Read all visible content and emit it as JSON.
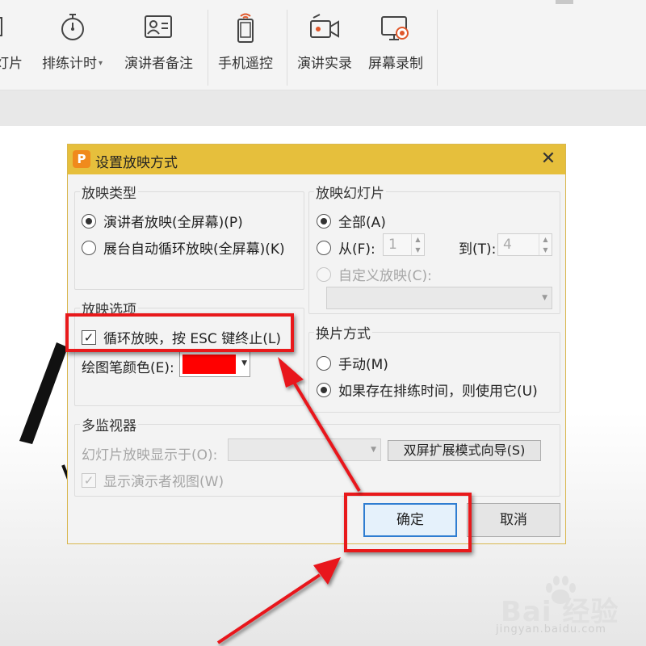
{
  "ribbon": {
    "items": [
      {
        "name": "slides",
        "label": "灯片",
        "icon": "slides-icon"
      },
      {
        "name": "rehearse-timings",
        "label": "排练计时",
        "icon": "stopwatch-icon",
        "has_dropdown": true
      },
      {
        "name": "speaker-notes",
        "label": "演讲者备注",
        "icon": "speaker-notes-icon"
      },
      {
        "name": "phone-remote",
        "label": "手机遥控",
        "icon": "phone-icon"
      },
      {
        "name": "record-presentation",
        "label": "演讲实录",
        "icon": "video-camera-icon"
      },
      {
        "name": "screen-recording",
        "label": "屏幕录制",
        "icon": "screen-record-icon"
      }
    ]
  },
  "dialog": {
    "title": "设置放映方式",
    "close_glyph": "✕",
    "show_type": {
      "legend": "放映类型",
      "options": [
        "演讲者放映(全屏幕)(P)",
        "展台自动循环放映(全屏幕)(K)"
      ],
      "selected": 0
    },
    "slides": {
      "legend": "放映幻灯片",
      "all": "全部(A)",
      "from": "从(F):",
      "from_value": "1",
      "to": "到(T):",
      "to_value": "4",
      "custom": "自定义放映(C):",
      "selected": "all"
    },
    "options": {
      "legend": "放映选项",
      "loop": "循环放映，按 ESC 键终止(L)",
      "loop_checked": true,
      "pen_color_label": "绘图笔颜色(E):",
      "pen_color": "#ff0000"
    },
    "advance": {
      "legend": "换片方式",
      "manual": "手动(M)",
      "timings": "如果存在排练时间，则使用它(U)",
      "selected": "timings"
    },
    "monitors": {
      "legend": "多监视器",
      "display_on": "幻灯片放映显示于(O):",
      "dual_screen_button": "双屏扩展模式向导(S)",
      "presenter_view": "显示演示者视图(W)",
      "presenter_view_checked": true
    },
    "ok": "确定",
    "cancel": "取消"
  },
  "watermark": {
    "brand": "Bai  经验",
    "site": "jingyan.baidu.com"
  },
  "colors": {
    "title_bar": "#e6bf3c",
    "app_icon": "#f08a1c",
    "highlight": "#e8191b",
    "primary_border": "#2f7dd1"
  }
}
